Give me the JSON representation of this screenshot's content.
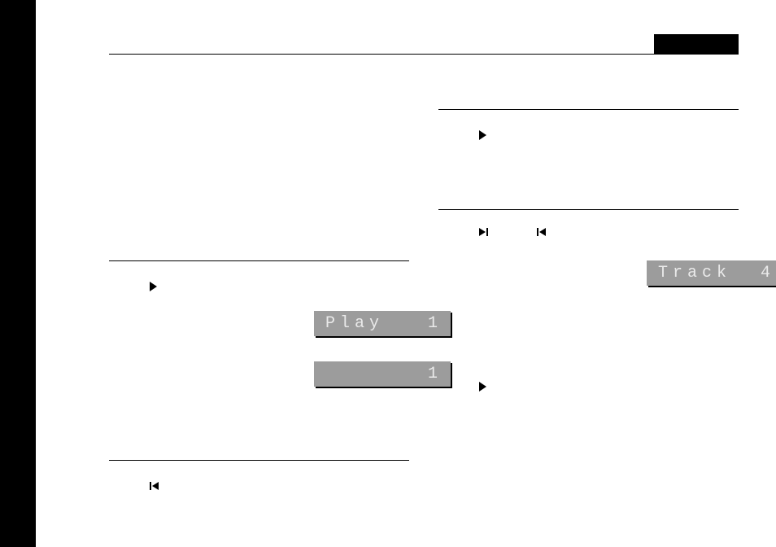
{
  "lcd": {
    "play_1": "Play   1",
    "count_1": "       1",
    "track_4": "Track  4"
  },
  "icons": {
    "play": "play-icon",
    "skip_next": "skip-next-icon",
    "skip_prev": "skip-prev-icon"
  }
}
